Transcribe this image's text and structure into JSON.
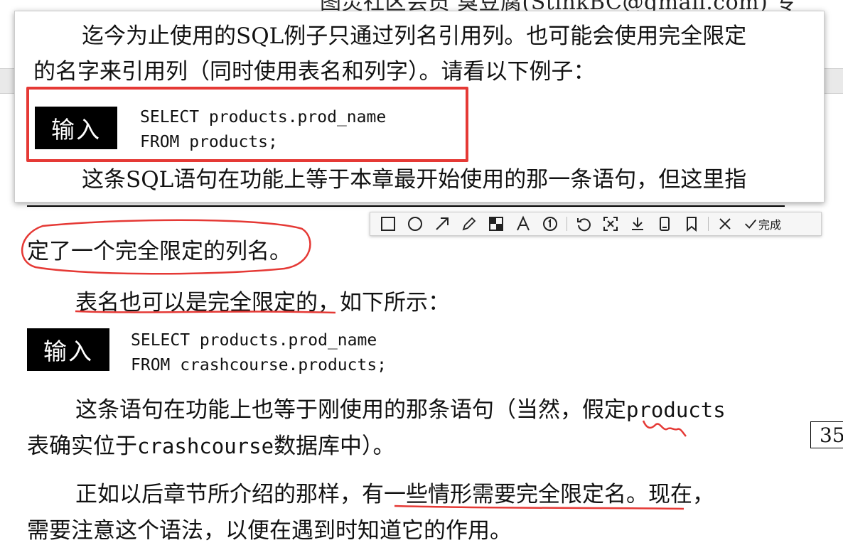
{
  "header": {
    "banner": "图灵社区会员 臭豆腐(StinkBC@gmail.com) 专"
  },
  "popup": {
    "para1_line1": "迄今为止使用的SQL例子只通过列名引用列。也可能会使用完全限定",
    "para1_line2": "的名字来引用列（同时使用表名和列字）。请看以下例子：",
    "badge": "输入",
    "code": [
      "SELECT products.prod_name",
      "FROM products;"
    ],
    "para2_line1": "这条SQL语句在功能上等于本章最开始使用的那一条语句，但这里指"
  },
  "toolbar": {
    "icons": [
      "rectangle-tool-icon",
      "ellipse-tool-icon",
      "arrow-tool-icon",
      "pencil-tool-icon",
      "mosaic-tool-icon",
      "text-tool-icon",
      "number-tool-icon",
      "undo-icon",
      "ocr-icon",
      "download-icon",
      "save-icon",
      "pin-icon",
      "close-icon",
      "check-icon"
    ],
    "done_label": "完成",
    "annotation_color": "#e53935"
  },
  "page": {
    "line_continue": "定了一个完全限定的列名。",
    "para3": "表名也可以是完全限定的，如下所示：",
    "badge2": "输入",
    "code2": [
      "SELECT products.prod_name",
      "FROM crashcourse.products;"
    ],
    "para4_line1_a": "这条语句在功能上也等于刚使用的那条语句（当然，假定",
    "para4_line1_b": "products",
    "para4_line2_a": "表确实位于",
    "para4_line2_b": "crashcourse",
    "para4_line2_c": "数据库中）。",
    "para5_line1": "正如以后章节所介绍的那样，有一些情形需要完全限定名。现在，",
    "para5_line2": "需要注意这个语法，以便在遇到时知道它的作用。",
    "page_number": "35"
  }
}
